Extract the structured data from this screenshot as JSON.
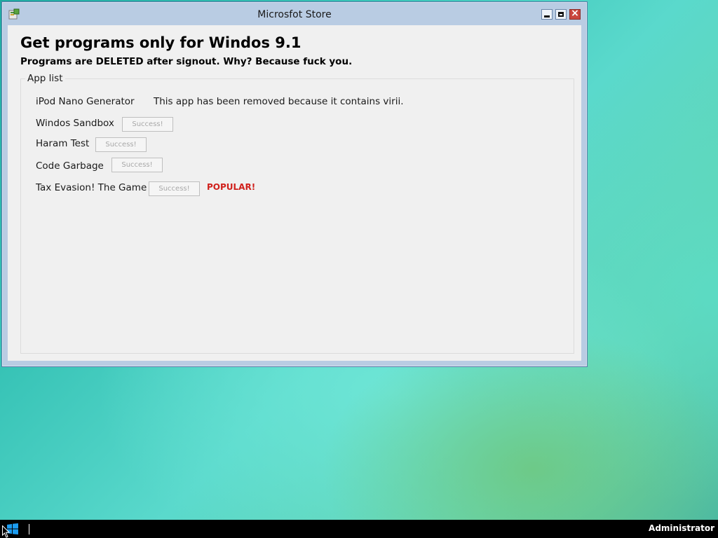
{
  "window": {
    "title": "Microsfot Store",
    "icon": "store-app-icon",
    "controls": {
      "minimize": "minimize-icon",
      "maximize": "maximize-icon",
      "close": "×"
    }
  },
  "header": {
    "title": "Get programs only for Windos 9.1",
    "subtitle": "Programs are DELETED after signout. Why? Because fuck you."
  },
  "app_list": {
    "label": "App list",
    "items": [
      {
        "name": "iPod Nano Generator",
        "note": "This app has been removed because it contains virii."
      },
      {
        "name": "Windos Sandbox",
        "button": "Success!"
      },
      {
        "name": "Haram Test",
        "button": "Success!"
      },
      {
        "name": "Code Garbage",
        "button": "Success!"
      },
      {
        "name": "Tax Evasion! The Game",
        "button": "Success!",
        "badge": "POPULAR!"
      }
    ]
  },
  "taskbar": {
    "start_icon": "windows-logo-icon",
    "user": "Administrator"
  },
  "colors": {
    "badge": "#d0201c",
    "close_button": "#c9463d",
    "window_frame": "#b9cce3",
    "taskbar": "#000000"
  }
}
